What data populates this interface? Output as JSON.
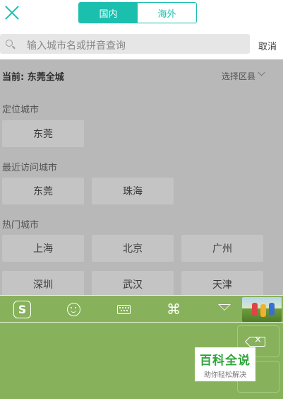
{
  "header": {
    "tabs": [
      {
        "label": "国内",
        "active": true
      },
      {
        "label": "海外",
        "active": false
      }
    ]
  },
  "search": {
    "placeholder": "输入城市名或拼音查询",
    "cancel_label": "取消"
  },
  "current": {
    "label": "当前: 东莞全城",
    "district_label": "选择区县"
  },
  "sections": {
    "location": {
      "title": "定位城市",
      "cities": [
        "东莞"
      ]
    },
    "recent": {
      "title": "最近访问城市",
      "cities": [
        "东莞",
        "珠海"
      ]
    },
    "hot": {
      "title": "热门城市",
      "cities": [
        "上海",
        "北京",
        "广州",
        "深圳",
        "武汉",
        "天津"
      ]
    }
  },
  "keyboard": {
    "toolbar_icons": [
      "sogou-logo-icon",
      "emoji-icon",
      "keyboard-icon",
      "command-icon",
      "hide-keyboard-icon",
      "skin-thumbnail"
    ],
    "logo_glyph": "S",
    "command_glyph": "⌘",
    "accent_color": "#87b25b"
  },
  "watermark": {
    "title": "百科全说",
    "subtitle": "助你轻松解决"
  }
}
